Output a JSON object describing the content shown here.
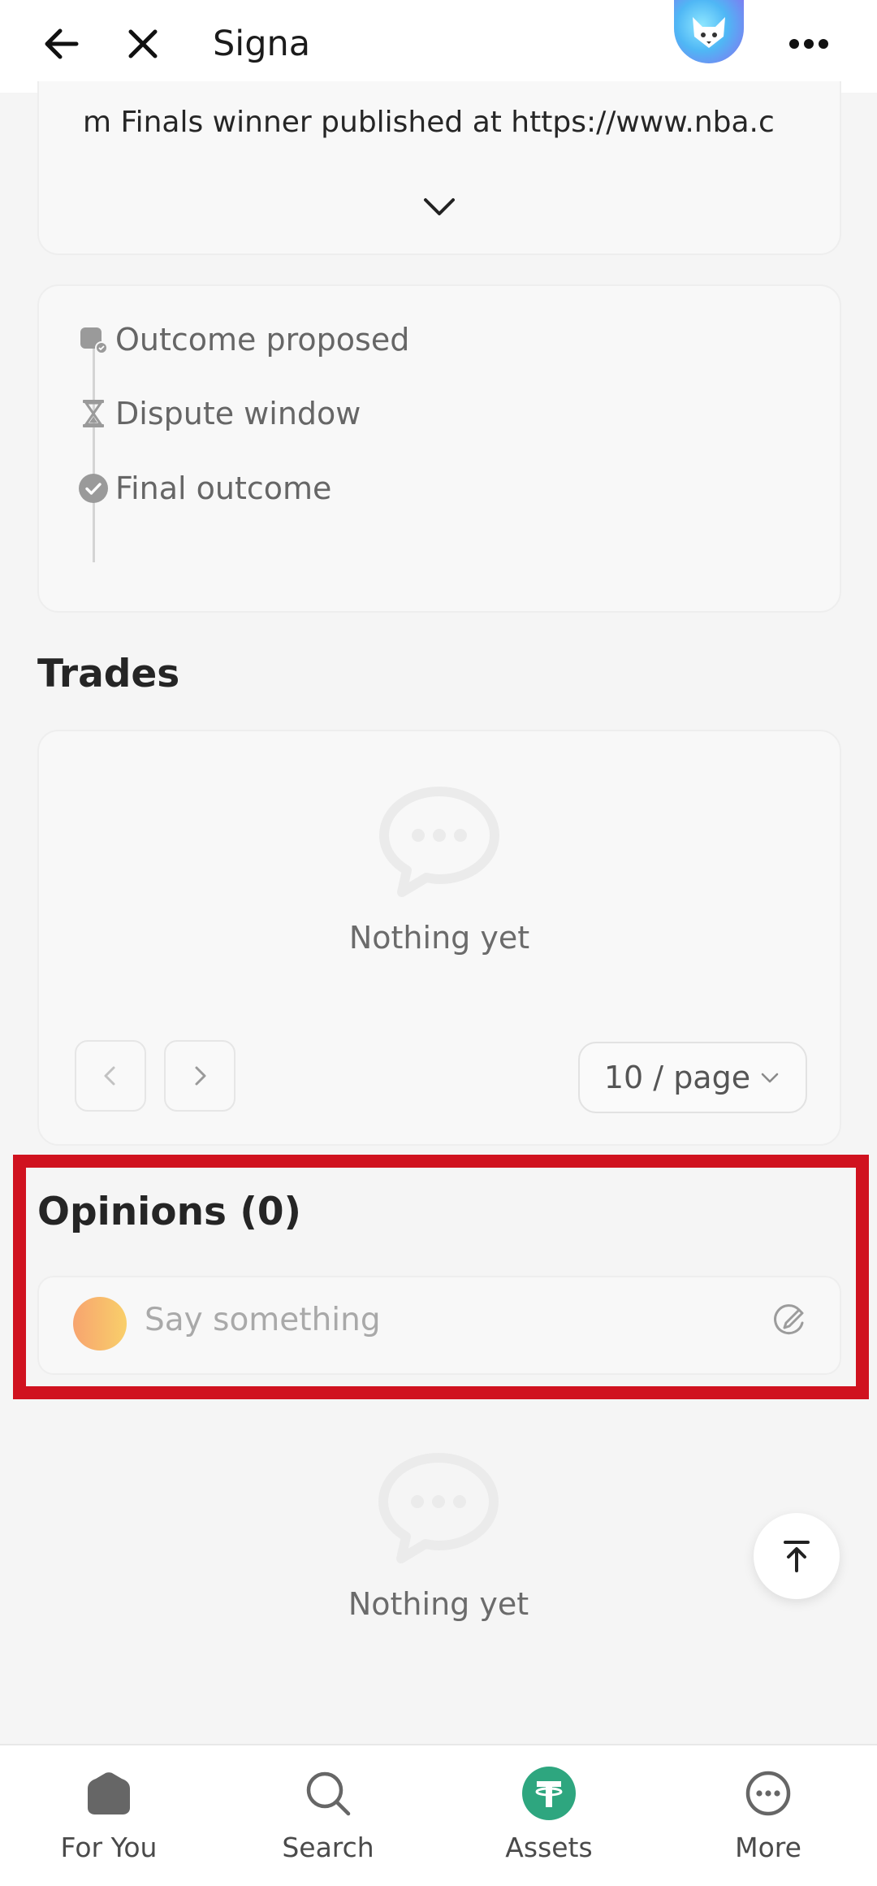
{
  "header": {
    "title": "Signa",
    "back_icon": "arrow-left-icon",
    "close_icon": "close-icon",
    "logo_icon": "fox-avatar-icon",
    "more_icon": "more-dots-icon"
  },
  "description": {
    "text": "m Finals winner published at https://www.nba.c",
    "expand_icon": "chevron-down-icon"
  },
  "timeline": {
    "steps": [
      {
        "label": "Outcome proposed",
        "icon": "proposal-icon"
      },
      {
        "label": "Dispute window",
        "icon": "hourglass-icon"
      },
      {
        "label": "Final outcome",
        "icon": "check-circle-icon"
      }
    ]
  },
  "trades": {
    "title": "Trades",
    "empty_text": "Nothing yet",
    "page_size": "10 / page"
  },
  "opinions": {
    "title": "Opinions (0)",
    "placeholder": "Say something",
    "empty_text": "Nothing yet"
  },
  "nav": {
    "items": [
      {
        "label": "For You",
        "icon": "home-icon"
      },
      {
        "label": "Search",
        "icon": "search-icon"
      },
      {
        "label": "Assets",
        "icon": "tether-icon"
      },
      {
        "label": "More",
        "icon": "more-circle-icon"
      }
    ]
  },
  "colors": {
    "highlight": "#d0121f",
    "assets_accent": "#2ea67f",
    "avatar_gradient_start": "#f7a46f",
    "avatar_gradient_end": "#f9cf6a"
  }
}
